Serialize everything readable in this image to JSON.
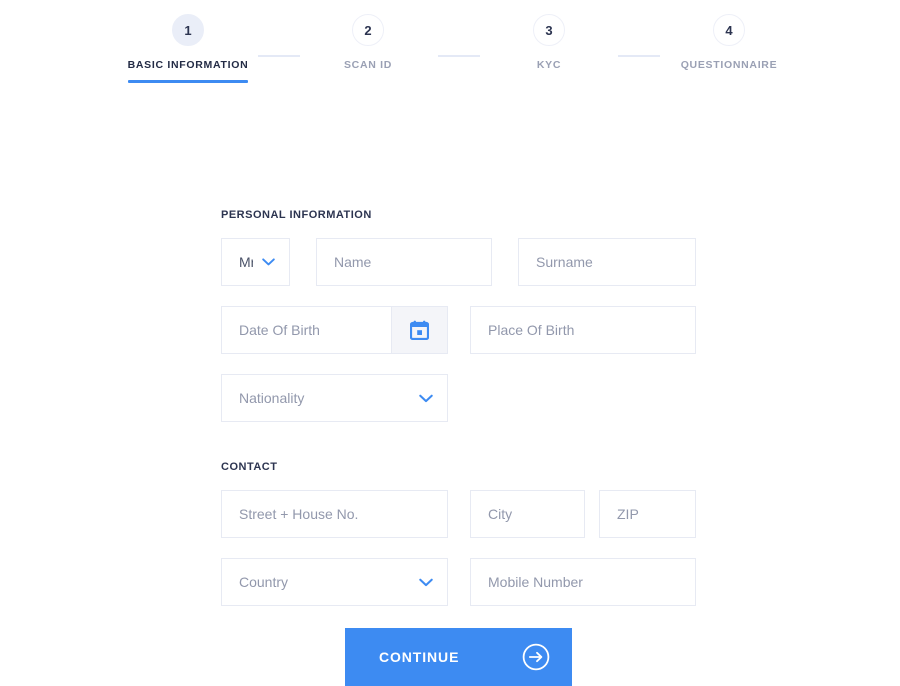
{
  "stepper": {
    "steps": [
      {
        "number": "1",
        "label": "BASIC INFORMATION",
        "state": "active"
      },
      {
        "number": "2",
        "label": "SCAN ID",
        "state": "inactive"
      },
      {
        "number": "3",
        "label": "KYC",
        "state": "inactive"
      },
      {
        "number": "4",
        "label": "QUESTIONNAIRE",
        "state": "inactive"
      }
    ],
    "active_color": "#3d8bf2",
    "active_circle_bg": "#eaeef8",
    "inactive_label_color": "#9aa0b4",
    "connector_color": "#e4e9f6"
  },
  "sections": {
    "personal_title": "PERSONAL INFORMATION",
    "contact_title": "CONTACT"
  },
  "fields": {
    "salutation": {
      "value": "Mr.",
      "icon": "chevron-down-icon"
    },
    "name": {
      "placeholder": "Name",
      "value": ""
    },
    "surname": {
      "placeholder": "Surname",
      "value": ""
    },
    "date_of_birth": {
      "placeholder": "Date Of Birth",
      "value": "",
      "icon": "calendar-icon"
    },
    "place_of_birth": {
      "placeholder": "Place Of Birth",
      "value": ""
    },
    "nationality": {
      "placeholder": "Nationality",
      "value": "",
      "icon": "chevron-down-icon"
    },
    "street": {
      "placeholder": "Street + House No.",
      "value": ""
    },
    "city": {
      "placeholder": "City",
      "value": ""
    },
    "zip": {
      "placeholder": "ZIP",
      "value": ""
    },
    "country": {
      "placeholder": "Country",
      "value": "",
      "icon": "chevron-down-icon"
    },
    "mobile": {
      "placeholder": "Mobile Number",
      "value": ""
    }
  },
  "continue": {
    "label": "CONTINUE",
    "icon": "arrow-right-circle-icon",
    "bg_color": "#3d8bf2",
    "text_color": "#ffffff"
  },
  "theme": {
    "page_bg": "#ffffff",
    "field_border": "#e7eaf3",
    "placeholder_color": "#9298ac",
    "heading_color": "#2c3450",
    "accent": "#3d8bf2"
  }
}
